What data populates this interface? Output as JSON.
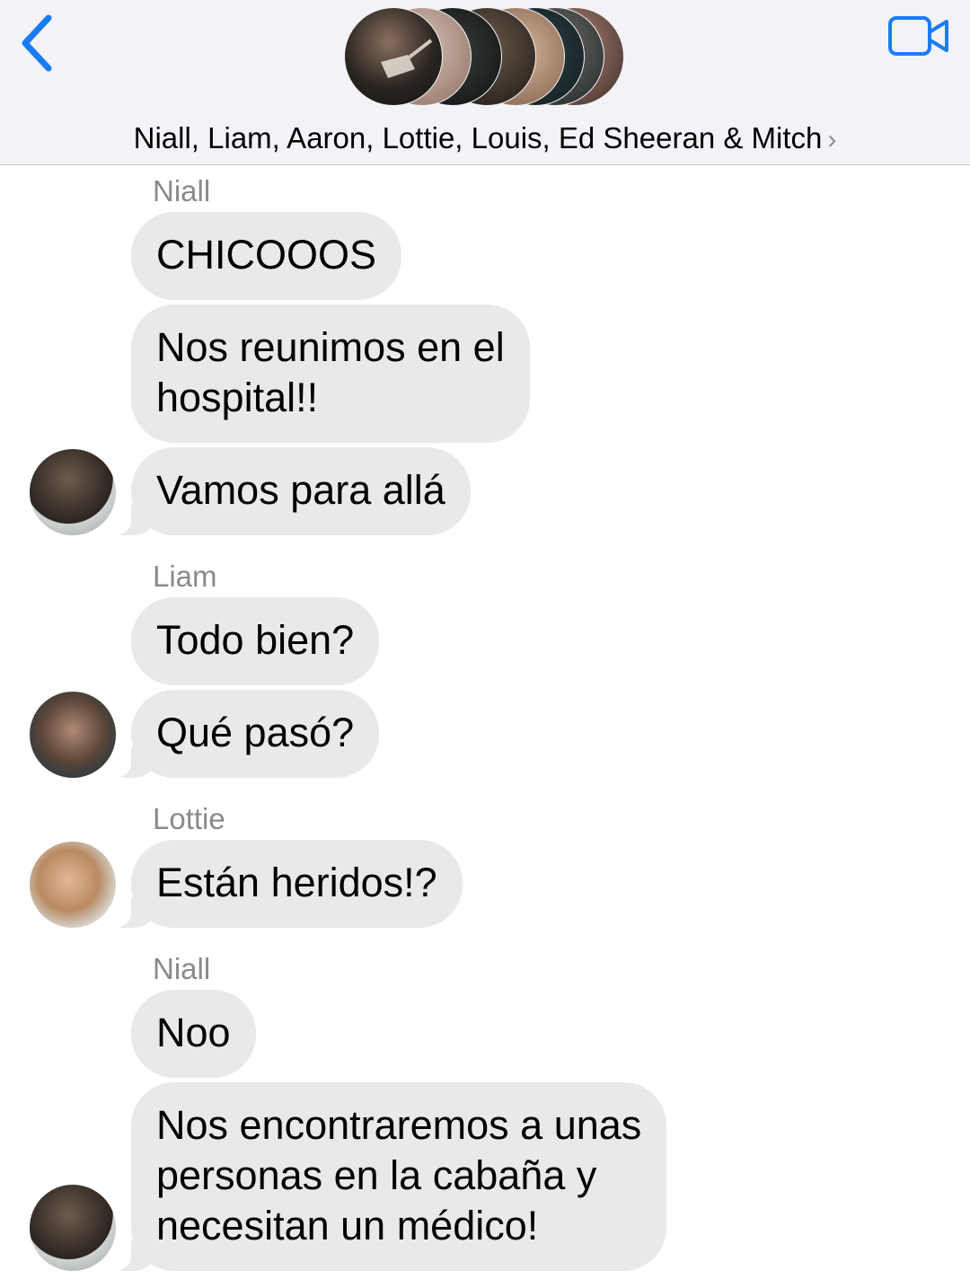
{
  "header": {
    "group_title": "Niall, Liam, Aaron, Lottie, Louis, Ed Sheeran & Mitch",
    "chevron": "›",
    "back_icon": "chevron-left-icon",
    "video_icon": "video-camera-icon"
  },
  "messages": [
    {
      "sender": "Niall",
      "texts": [
        "CHICOOOS",
        "Nos reunimos en el\nhospital!!",
        "Vamos para allá"
      ]
    },
    {
      "sender": "Liam",
      "texts": [
        "Todo bien?",
        "Qué pasó?"
      ]
    },
    {
      "sender": "Lottie",
      "texts": [
        "Están heridos!?"
      ]
    },
    {
      "sender": "Niall",
      "texts": [
        "Noo",
        "Nos encontraremos a unas\npersonas en la cabaña y\nnecesitan un médico!"
      ]
    }
  ],
  "colors": {
    "accent": "#1a7cf5",
    "bubble": "#e9e9eb",
    "header_bg": "#f2f2f7",
    "sender_label": "#8a8a8e"
  }
}
